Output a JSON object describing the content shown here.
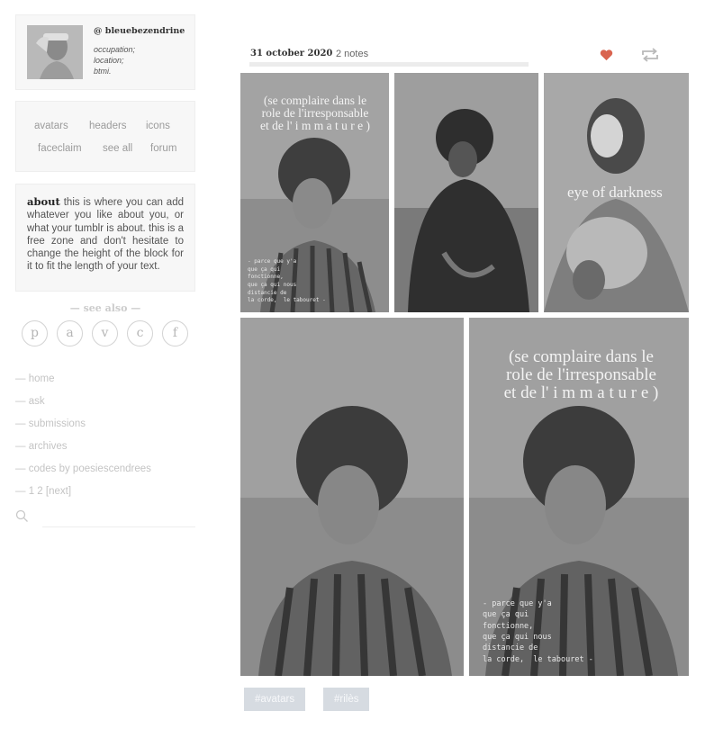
{
  "profile": {
    "username": "@ bleuebezendrine",
    "meta": [
      "occupation;",
      "location;",
      "btmi."
    ]
  },
  "links": [
    "avatars",
    "headers",
    "icons",
    "faceclaim",
    "see all",
    "forum"
  ],
  "about": {
    "heading": "about",
    "text": "this is where you can add whatever you like about you, or what your tumblr is about. this is a free zone and don't hesitate to change the height of the block for it to fit the length of your text."
  },
  "see_also": {
    "label": "— see also —",
    "letters": [
      "p",
      "a",
      "v",
      "c",
      "f"
    ]
  },
  "nav": [
    "home",
    "ask",
    "submissions",
    "archives",
    "codes by poesiescendrees",
    "1 2  [next]"
  ],
  "nav_prefix": "—",
  "search": {
    "placeholder": ""
  },
  "post": {
    "date": "31 october 2020",
    "notes": "2 notes",
    "quote": "(se complaire dans le role de l'irresponsable et de l' i m m a t u r e )",
    "eye_text": "eye of darkness",
    "small_note": "- parce que y'a\nque ça qui\nfonctionne,\nque ça qui nous\ndistancie de\nla corde,  le tabouret -",
    "tags": [
      "#avatars",
      "#rilès"
    ]
  },
  "colors": {
    "heart": "#d9644f",
    "tag_bg": "#d6dbe1",
    "link_highlight": "#dfd6cb",
    "box_bg": "#f7f7f7"
  },
  "icons": [
    "search-icon",
    "heart-icon",
    "reblog-icon"
  ]
}
